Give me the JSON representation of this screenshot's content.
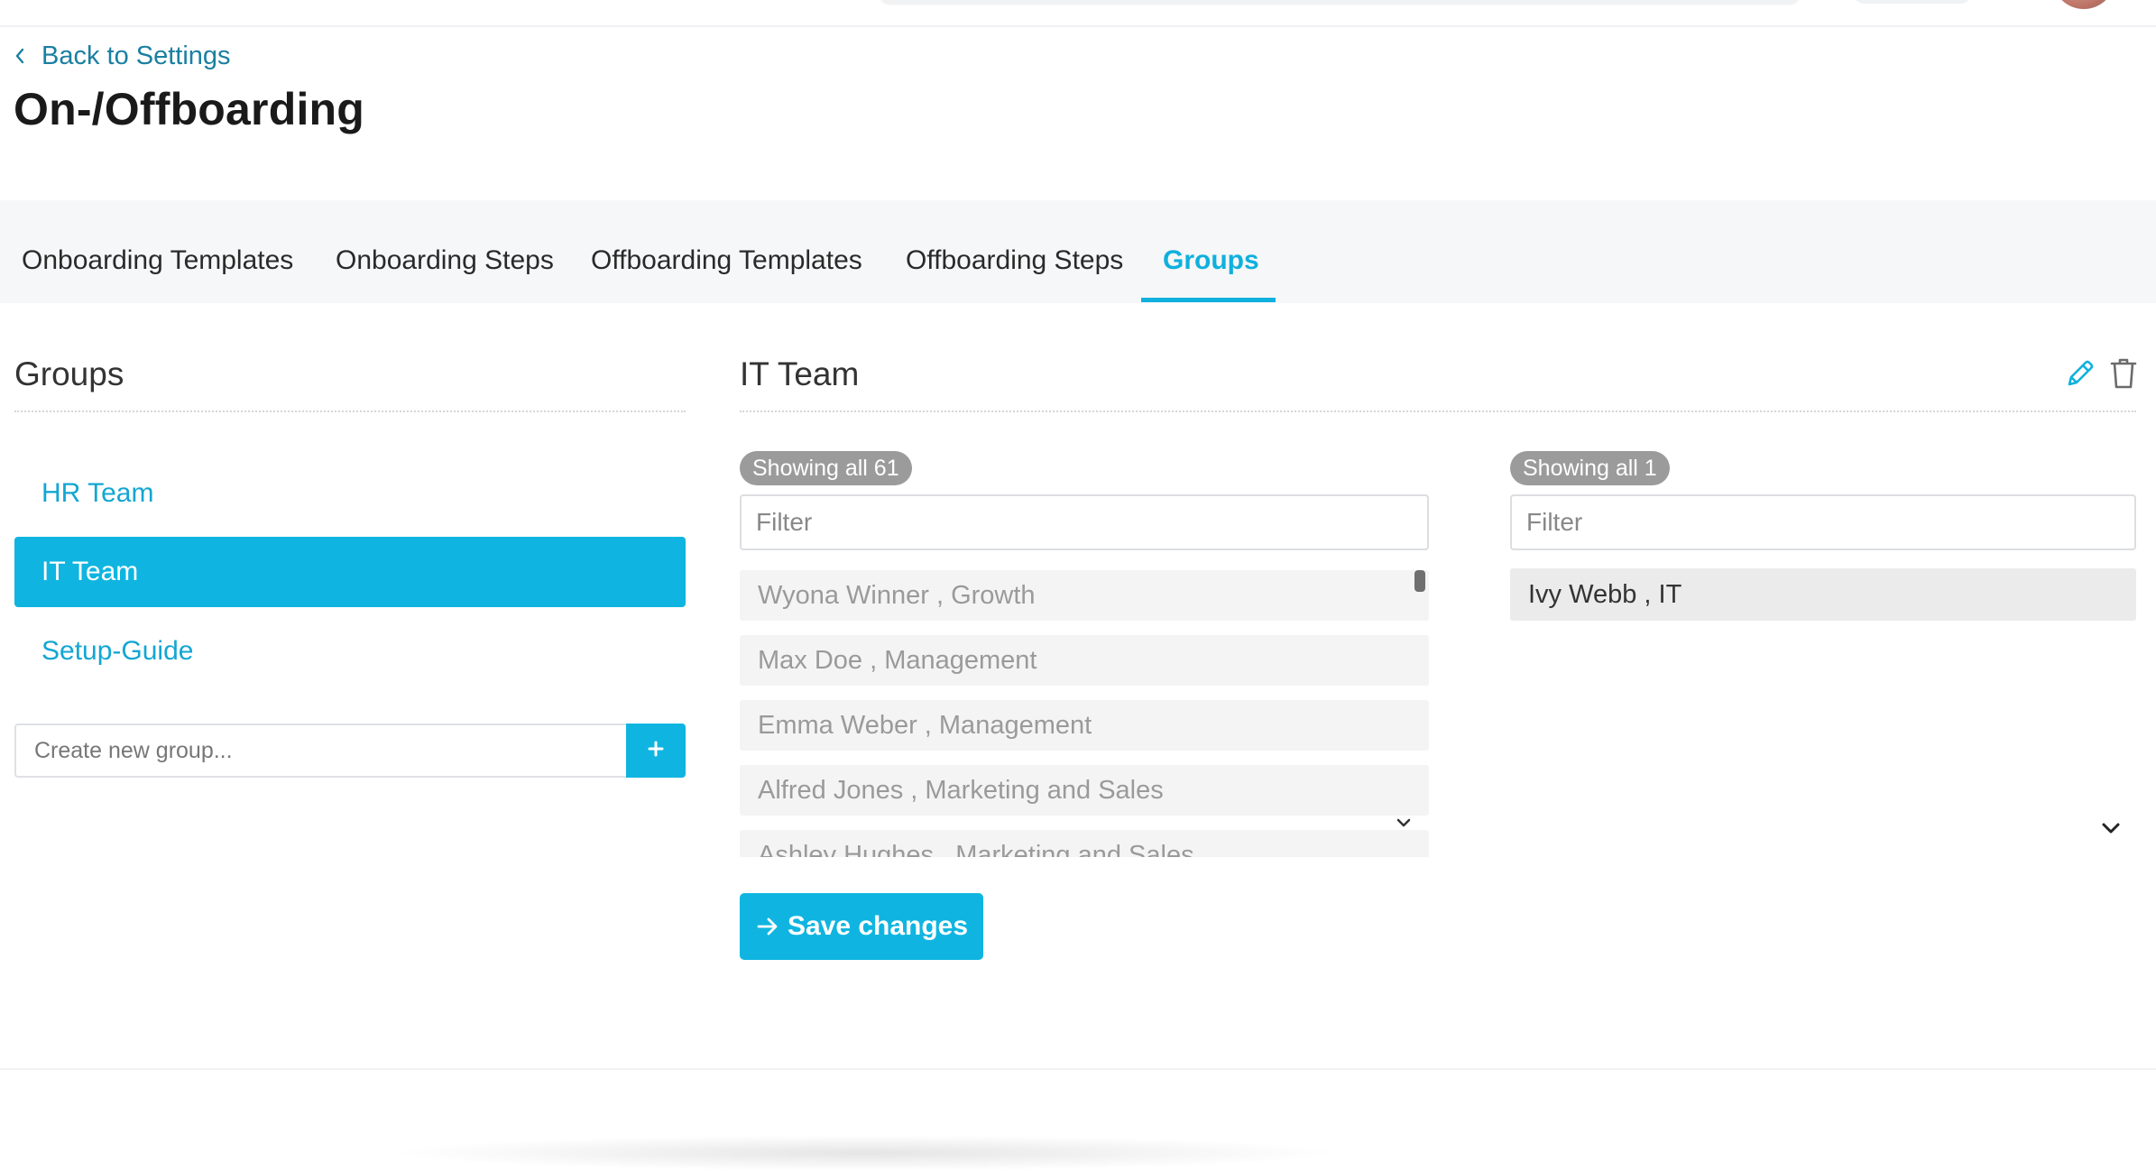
{
  "header": {
    "back_label": "Back to Settings",
    "page_title": "On-/Offboarding"
  },
  "tabs": [
    {
      "label": "Onboarding Templates"
    },
    {
      "label": "Onboarding Steps"
    },
    {
      "label": "Offboarding Templates"
    },
    {
      "label": "Offboarding Steps"
    },
    {
      "label": "Groups",
      "active": true
    }
  ],
  "groups_panel": {
    "title": "Groups",
    "items": [
      {
        "label": "HR Team"
      },
      {
        "label": "IT Team",
        "selected": true
      },
      {
        "label": "Setup-Guide"
      }
    ],
    "new_group_placeholder": "Create new group..."
  },
  "detail": {
    "title": "IT Team",
    "available": {
      "badge": "Showing all 61",
      "filter_placeholder": "Filter",
      "rows": [
        "Wyona Winner , Growth",
        "Max Doe , Management",
        "Emma Weber , Management",
        "Alfred Jones , Marketing and Sales",
        "Ashley Hughes , Marketing and Sales"
      ]
    },
    "selected": {
      "badge": "Showing all 1",
      "filter_placeholder": "Filter",
      "rows": [
        "Ivy Webb , IT"
      ]
    },
    "save_label": "Save changes"
  },
  "icons": {
    "back": "chevron-left-icon",
    "edit": "pencil-icon",
    "delete": "trash-icon",
    "add": "plus-icon",
    "save": "arrow-right-icon",
    "expand": "chevron-down-icon"
  },
  "colors": {
    "accent": "#0fb5e0",
    "link": "#1a7fa1",
    "badge": "#9b9b9b"
  }
}
